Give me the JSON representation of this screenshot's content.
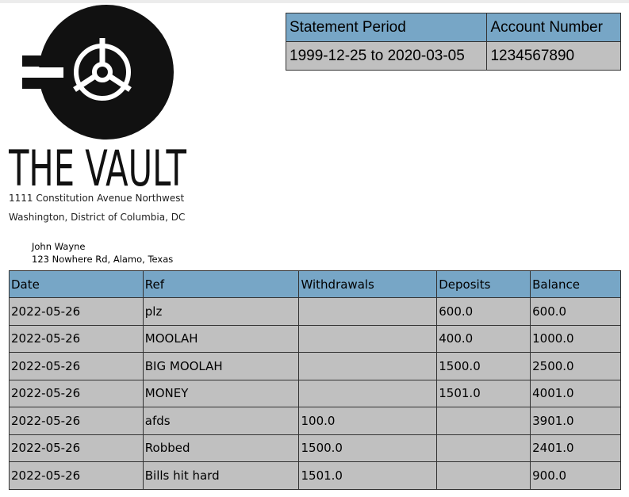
{
  "bank": {
    "name": "THE VAULT",
    "address_line1": "1111 Constitution Avenue Northwest",
    "address_line2": "Washington, District of Columbia, DC",
    "logo_icon": "vault-logo-icon"
  },
  "customer": {
    "name": "John Wayne",
    "address": "123 Nowhere Rd, Alamo, Texas"
  },
  "statement": {
    "headers": [
      "Statement Period",
      "Account Number"
    ],
    "period": "1999-12-25 to 2020-03-05",
    "account_number": "1234567890"
  },
  "transactions": {
    "headers": [
      "Date",
      "Ref",
      "Withdrawals",
      "Deposits",
      "Balance"
    ],
    "rows": [
      [
        "2022-05-26",
        "plz",
        "",
        "600.0",
        "600.0"
      ],
      [
        "2022-05-26",
        "MOOLAH",
        "",
        "400.0",
        "1000.0"
      ],
      [
        "2022-05-26",
        "BIG MOOLAH",
        "",
        "1500.0",
        "2500.0"
      ],
      [
        "2022-05-26",
        "MONEY",
        "",
        "1501.0",
        "4001.0"
      ],
      [
        "2022-05-26",
        "afds",
        "100.0",
        "",
        "3901.0"
      ],
      [
        "2022-05-26",
        "Robbed",
        "1500.0",
        "",
        "2401.0"
      ],
      [
        "2022-05-26",
        "Bills hit hard",
        "1501.0",
        "",
        "900.0"
      ]
    ]
  },
  "colors": {
    "header_bg": "#77a6c6",
    "cell_bg": "#c0c0c0",
    "border": "#333333",
    "logo": "#111111"
  }
}
